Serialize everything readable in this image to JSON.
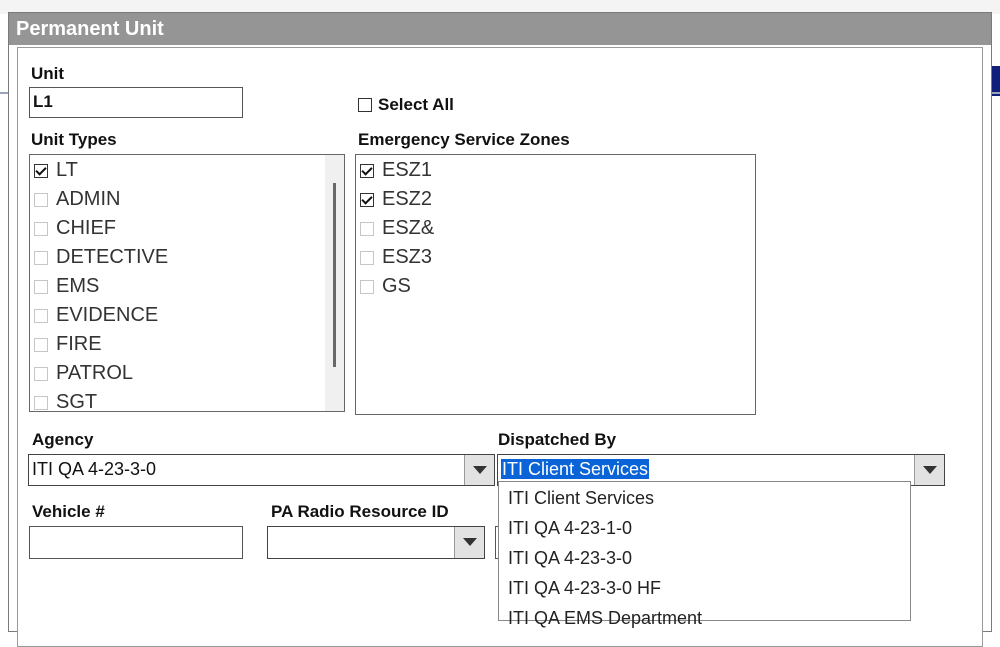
{
  "dialog": {
    "title": "Permanent Unit"
  },
  "unit": {
    "label": "Unit",
    "value": "L1"
  },
  "select_all": {
    "label": "Select All",
    "checked": false
  },
  "unit_types": {
    "label": "Unit Types",
    "items": [
      {
        "label": "LT",
        "checked": true
      },
      {
        "label": "ADMIN",
        "checked": false
      },
      {
        "label": "CHIEF",
        "checked": false
      },
      {
        "label": "DETECTIVE",
        "checked": false
      },
      {
        "label": "EMS",
        "checked": false
      },
      {
        "label": "EVIDENCE",
        "checked": false
      },
      {
        "label": "FIRE",
        "checked": false
      },
      {
        "label": "PATROL",
        "checked": false
      },
      {
        "label": "SGT",
        "checked": false
      }
    ]
  },
  "esz": {
    "label": "Emergency Service Zones",
    "items": [
      {
        "label": "ESZ1",
        "checked": true
      },
      {
        "label": "ESZ2",
        "checked": true
      },
      {
        "label": "ESZ&",
        "checked": false
      },
      {
        "label": "ESZ3",
        "checked": false
      },
      {
        "label": "GS",
        "checked": false
      }
    ]
  },
  "agency": {
    "label": "Agency",
    "value": "ITI QA 4-23-3-0"
  },
  "dispatched_by": {
    "label": "Dispatched By",
    "value": "ITI Client Services",
    "options": [
      "ITI Client Services",
      "ITI QA 4-23-1-0",
      "ITI QA 4-23-3-0",
      "ITI QA 4-23-3-0 HF",
      "ITI QA EMS Department"
    ]
  },
  "vehicle": {
    "label": "Vehicle #",
    "value": ""
  },
  "pa_radio": {
    "label": "PA Radio Resource ID",
    "value": ""
  },
  "colors": {
    "title_bar": "#959595",
    "selection": "#0a64d8"
  }
}
